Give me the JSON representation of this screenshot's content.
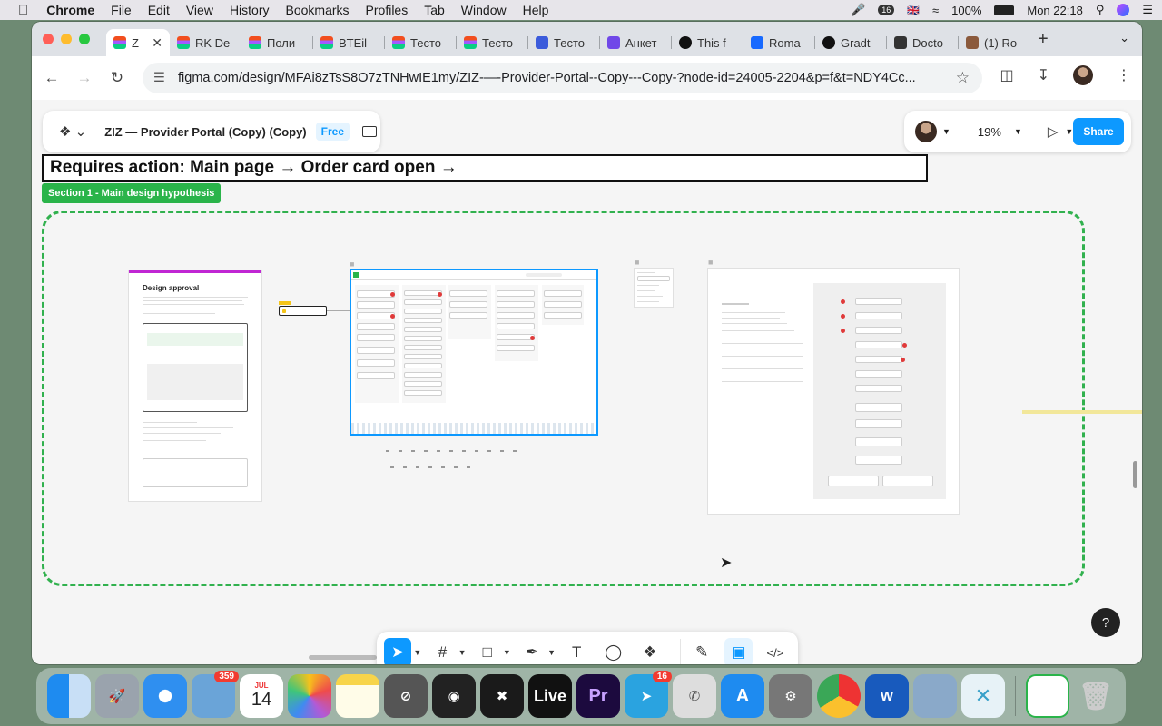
{
  "menubar": {
    "app": "Chrome",
    "items": [
      "File",
      "Edit",
      "View",
      "History",
      "Bookmarks",
      "Profiles",
      "Tab",
      "Window",
      "Help"
    ],
    "battery": "100%",
    "clock": "Mon 22:18"
  },
  "tabs": [
    {
      "label": "Z",
      "active": true,
      "color": "#a259ff"
    },
    {
      "label": "RK De",
      "color": "#f24e1e"
    },
    {
      "label": "Поли",
      "color": "#f24e1e"
    },
    {
      "label": "BTEil",
      "color": "#f24e1e"
    },
    {
      "label": "Тесто",
      "color": "#f24e1e"
    },
    {
      "label": "Тесто",
      "color": "#f24e1e"
    },
    {
      "label": "Тесто",
      "color": "#3b5bdb"
    },
    {
      "label": "Анкет",
      "color": "#7048e8"
    },
    {
      "label": "This f",
      "color": "#111111"
    },
    {
      "label": "Roma",
      "color": "#1769ff"
    },
    {
      "label": "Gradt",
      "color": "#111111"
    },
    {
      "label": "Docto",
      "color": "#333333"
    },
    {
      "label": "(1) Ro",
      "color": "#8b5a3c"
    }
  ],
  "url": "figma.com/design/MFAi8zTsS8O7zTNHwIE1my/ZIZ-—-Provider-Portal--Copy---Copy-?node-id=24005-2204&p=f&t=NDY4Cc...",
  "figma": {
    "file_name": "ZIZ — Provider Portal (Copy) (Copy)",
    "plan": "Free",
    "zoom": "19%",
    "share": "Share"
  },
  "canvas": {
    "section_title": "Requires action: Main page → Order card open →",
    "section_tag": "Section 1 - Main design hypothesis",
    "design_approval": {
      "title": "Design approval"
    }
  },
  "dock_badges": {
    "mail": "359",
    "telegram": "16"
  },
  "calendar": {
    "month": "JUL",
    "day": "14"
  },
  "help": "?"
}
